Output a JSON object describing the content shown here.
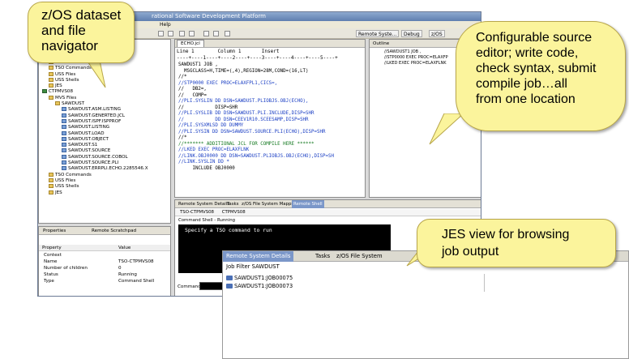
{
  "ide": {
    "title": "rational Software Development Platform",
    "menu": "Help",
    "perspectives": [
      "Remote Syste...",
      "Debug",
      "z/OS"
    ]
  },
  "rse_tree": {
    "rows": [
      {
        "label": "New Connection",
        "indent": 0,
        "icon": "folder"
      },
      {
        "label": "Local",
        "indent": 0,
        "icon": "folder"
      },
      {
        "label": "CTPMVS07",
        "indent": 0,
        "icon": "sys"
      },
      {
        "label": "MVS Files",
        "indent": 1,
        "icon": "folder"
      },
      {
        "label": "TSO Commands",
        "indent": 1,
        "icon": "folder"
      },
      {
        "label": "USS Files",
        "indent": 1,
        "icon": "folder"
      },
      {
        "label": "USS Shells",
        "indent": 1,
        "icon": "folder"
      },
      {
        "label": "JES",
        "indent": 1,
        "icon": "folder"
      },
      {
        "label": "CTPMVS08",
        "indent": 0,
        "icon": "sys"
      },
      {
        "label": "MVS Files",
        "indent": 1,
        "icon": "folder"
      },
      {
        "label": "SAWDUST",
        "indent": 2,
        "icon": "folder"
      },
      {
        "label": "SAWDUST.ASM.LISTING",
        "indent": 3,
        "icon": "ds"
      },
      {
        "label": "SAWDUST.GENERTED.JCL",
        "indent": 3,
        "icon": "ds"
      },
      {
        "label": "SAWDUST.ISPF.ISPPROF",
        "indent": 3,
        "icon": "ds"
      },
      {
        "label": "SAWDUST.LISTING",
        "indent": 3,
        "icon": "ds"
      },
      {
        "label": "SAWDUST.LOAD",
        "indent": 3,
        "icon": "ds"
      },
      {
        "label": "SAWDUST.OBJECT",
        "indent": 3,
        "icon": "ds"
      },
      {
        "label": "SAWDUST.S1",
        "indent": 3,
        "icon": "ds"
      },
      {
        "label": "SAWDUST.SOURCE",
        "indent": 3,
        "icon": "ds"
      },
      {
        "label": "SAWDUST.SOURCE.COBOL",
        "indent": 3,
        "icon": "ds"
      },
      {
        "label": "SAWDUST.SOURCE.PLI",
        "indent": 3,
        "icon": "ds"
      },
      {
        "label": "SAWDUST.ERRPLI.ECHO.2285546.X",
        "indent": 3,
        "icon": "ds"
      },
      {
        "label": "TSO Commands",
        "indent": 1,
        "icon": "folder"
      },
      {
        "label": "USS Files",
        "indent": 1,
        "icon": "folder"
      },
      {
        "label": "USS Shells",
        "indent": 1,
        "icon": "folder"
      },
      {
        "label": "JES",
        "indent": 1,
        "icon": "folder"
      }
    ]
  },
  "properties": {
    "tabs": [
      "Properties",
      "Remote Scratchpad"
    ],
    "header": {
      "property": "Property",
      "value": "Value"
    },
    "rows": [
      {
        "k": "Context",
        "v": ""
      },
      {
        "k": "Name",
        "v": "TSO-CTPMVS08"
      },
      {
        "k": "Number of children",
        "v": "0"
      },
      {
        "k": "Status",
        "v": "Running"
      },
      {
        "k": "Type",
        "v": "Command Shell"
      }
    ]
  },
  "editor": {
    "tab": "ECHO.jcl",
    "ruler_line": "Line 1        Column 1       Insert",
    "ruler_cols": "----+----1----+----2----+----3----+----4----+----5----+",
    "code": [
      "SAWDUST1 JOB ,",
      "  MSGCLASS=H,TIME=(,4),REGION=28M,COND=(16,LT)",
      "//*",
      "//STP0000 EXEC PROC=ELAXFPL1,CICS=,",
      "//   DB2=,",
      "//   COMP=",
      "//PLI.SYSLIN DD DSN=SAWDUST.PLIOBJS.OBJ(ECHO),",
      "//           DISP=SHR",
      "//PLI.SYSLIB DD DSN=SAWDUST.PLI.INCLUDE,DISP=SHR",
      "//           DD DSN=CEEV1R10.SCEESAMP,DISP=SHR",
      "//PLI.SYSXMLSD DD DUMMY",
      "//PLI.SYSIN DD DSN=SAWDUST.SOURCE.PLI(ECHO),DISP=SHR",
      "//*",
      "//******* ADDITIONAL JCL FOR COMPILE HERE ******",
      "//LKED EXEC PROC=ELAXFLNK",
      "//LINK.OBJ0000 DD DSN=SAWDUST.PLIOBJS.OBJ(ECHO),DISP=SH",
      "//LINK.SYSLIN DD *",
      "     INCLUDE OBJ0000"
    ]
  },
  "outline": {
    "tab": "Outline",
    "items": [
      "//SAWDUST1 JOB ,",
      "//STP0000 EXEC PROC=ELAXFP",
      "//LKED EXEC PROC=ELAXFLNK"
    ]
  },
  "shell": {
    "tabs": [
      "Remote System Details",
      "Tasks",
      "z/OS File System Mapping",
      "Remote Shell"
    ],
    "sub_tabs": [
      "TSO-CTPMVS08",
      "CTPMVS08"
    ],
    "status": "Command Shell - Running",
    "prompt": "Specify a TSO command to run",
    "command_label": "Command"
  },
  "jes": {
    "tabs": [
      "Remote System Details",
      "Tasks",
      "z/OS File System"
    ],
    "filter": "Job Filter SAWDUST",
    "jobs": [
      "SAWDUST1:JOB00075",
      "SAWDUST1:JOB00073"
    ]
  },
  "callouts": {
    "navigator": "z/OS dataset\nand file\nnavigator",
    "editor": "Configurable source\neditor; write code,\ncheck syntax, submit\ncompile job…all\nfrom one location",
    "jes": "JES view for browsing\njob output"
  },
  "colors": {
    "callout_fill": "#fbf49c",
    "active_tab": "#7b97c9",
    "jcl_keyword": "#1b3fc4",
    "jcl_param": "#c8201a",
    "jcl_comment": "#167a22"
  }
}
